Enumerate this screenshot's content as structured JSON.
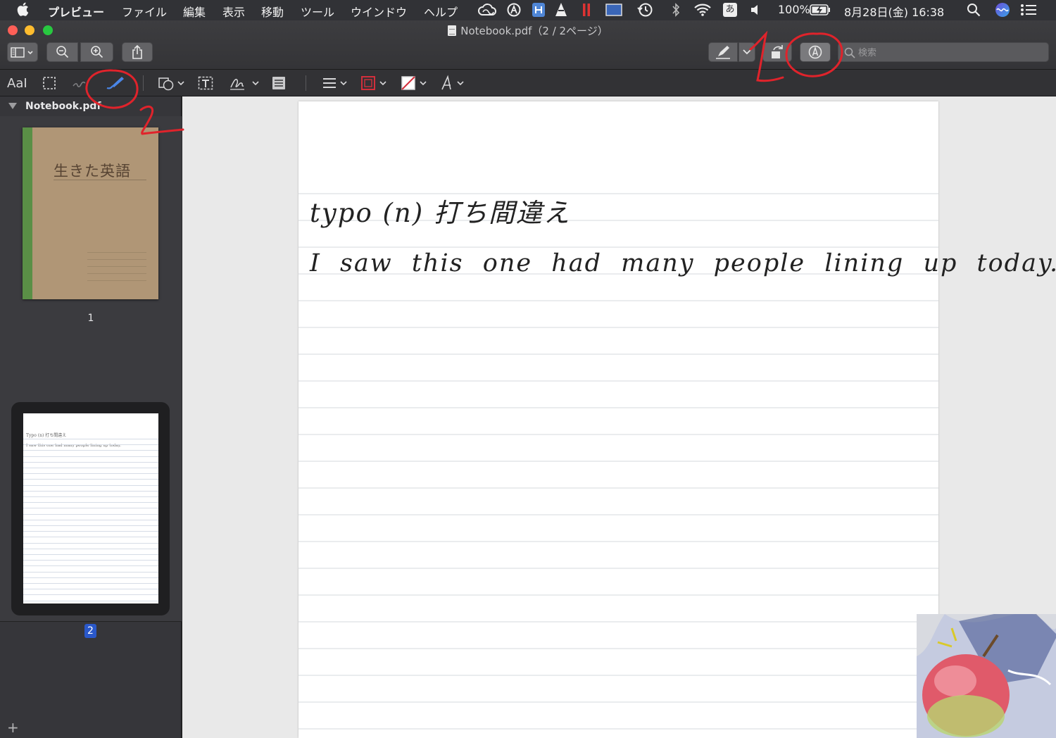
{
  "menubar": {
    "app_name": "プレビュー",
    "items": [
      "ファイル",
      "編集",
      "表示",
      "移動",
      "ツール",
      "ウインドウ",
      "ヘルプ"
    ],
    "battery": "100%",
    "clock": "8月28日(金) 16:38",
    "input_method": "あ"
  },
  "window": {
    "title": "Notebook.pdf（2 / 2ページ）"
  },
  "search": {
    "placeholder": "検索"
  },
  "markup": {
    "text_style_label": "AaI"
  },
  "sidebar": {
    "filename": "Notebook.pdf",
    "pages": [
      {
        "number": "1",
        "cover_title": "生きた英語"
      },
      {
        "number": "2",
        "line1": "Typo (n) 打ち間違え",
        "line2": "I saw this one had many people lining up today."
      }
    ]
  },
  "document": {
    "line1": "typo (n) 打ち間違え",
    "line2": "I saw this one had many people lining up today."
  },
  "annotations": {
    "label_1": "1",
    "label_2": "2"
  },
  "colors": {
    "annotation_red": "#e0232b",
    "selected_page_badge": "#2a58c9",
    "active_pen_tool": "#4a86e8"
  }
}
